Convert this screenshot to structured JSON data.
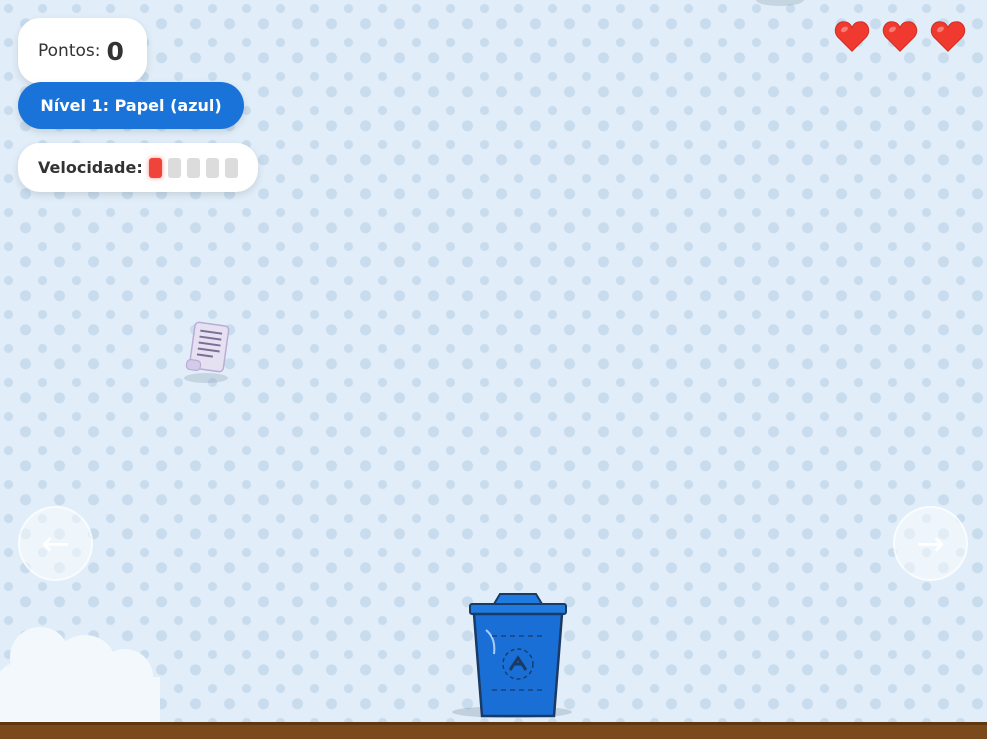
{
  "hud": {
    "score_label": "Pontos:",
    "score_value": "0",
    "level_label": "Nível 1: Papel (azul)",
    "speed_label": "Velocidade:",
    "speed_level": 1,
    "speed_max": 5,
    "lives": 3
  },
  "controls": {
    "left_arrow": "←",
    "right_arrow": "→"
  },
  "game": {
    "falling_item": "paper-document-icon",
    "bin_type": "paper-recycle-bin",
    "bin_color": "#1a73d9",
    "ground_color": "#7a4a1d"
  },
  "colors": {
    "accent": "#1a73d9",
    "heart": "#f03a2f",
    "speed_active": "#f0433a"
  }
}
